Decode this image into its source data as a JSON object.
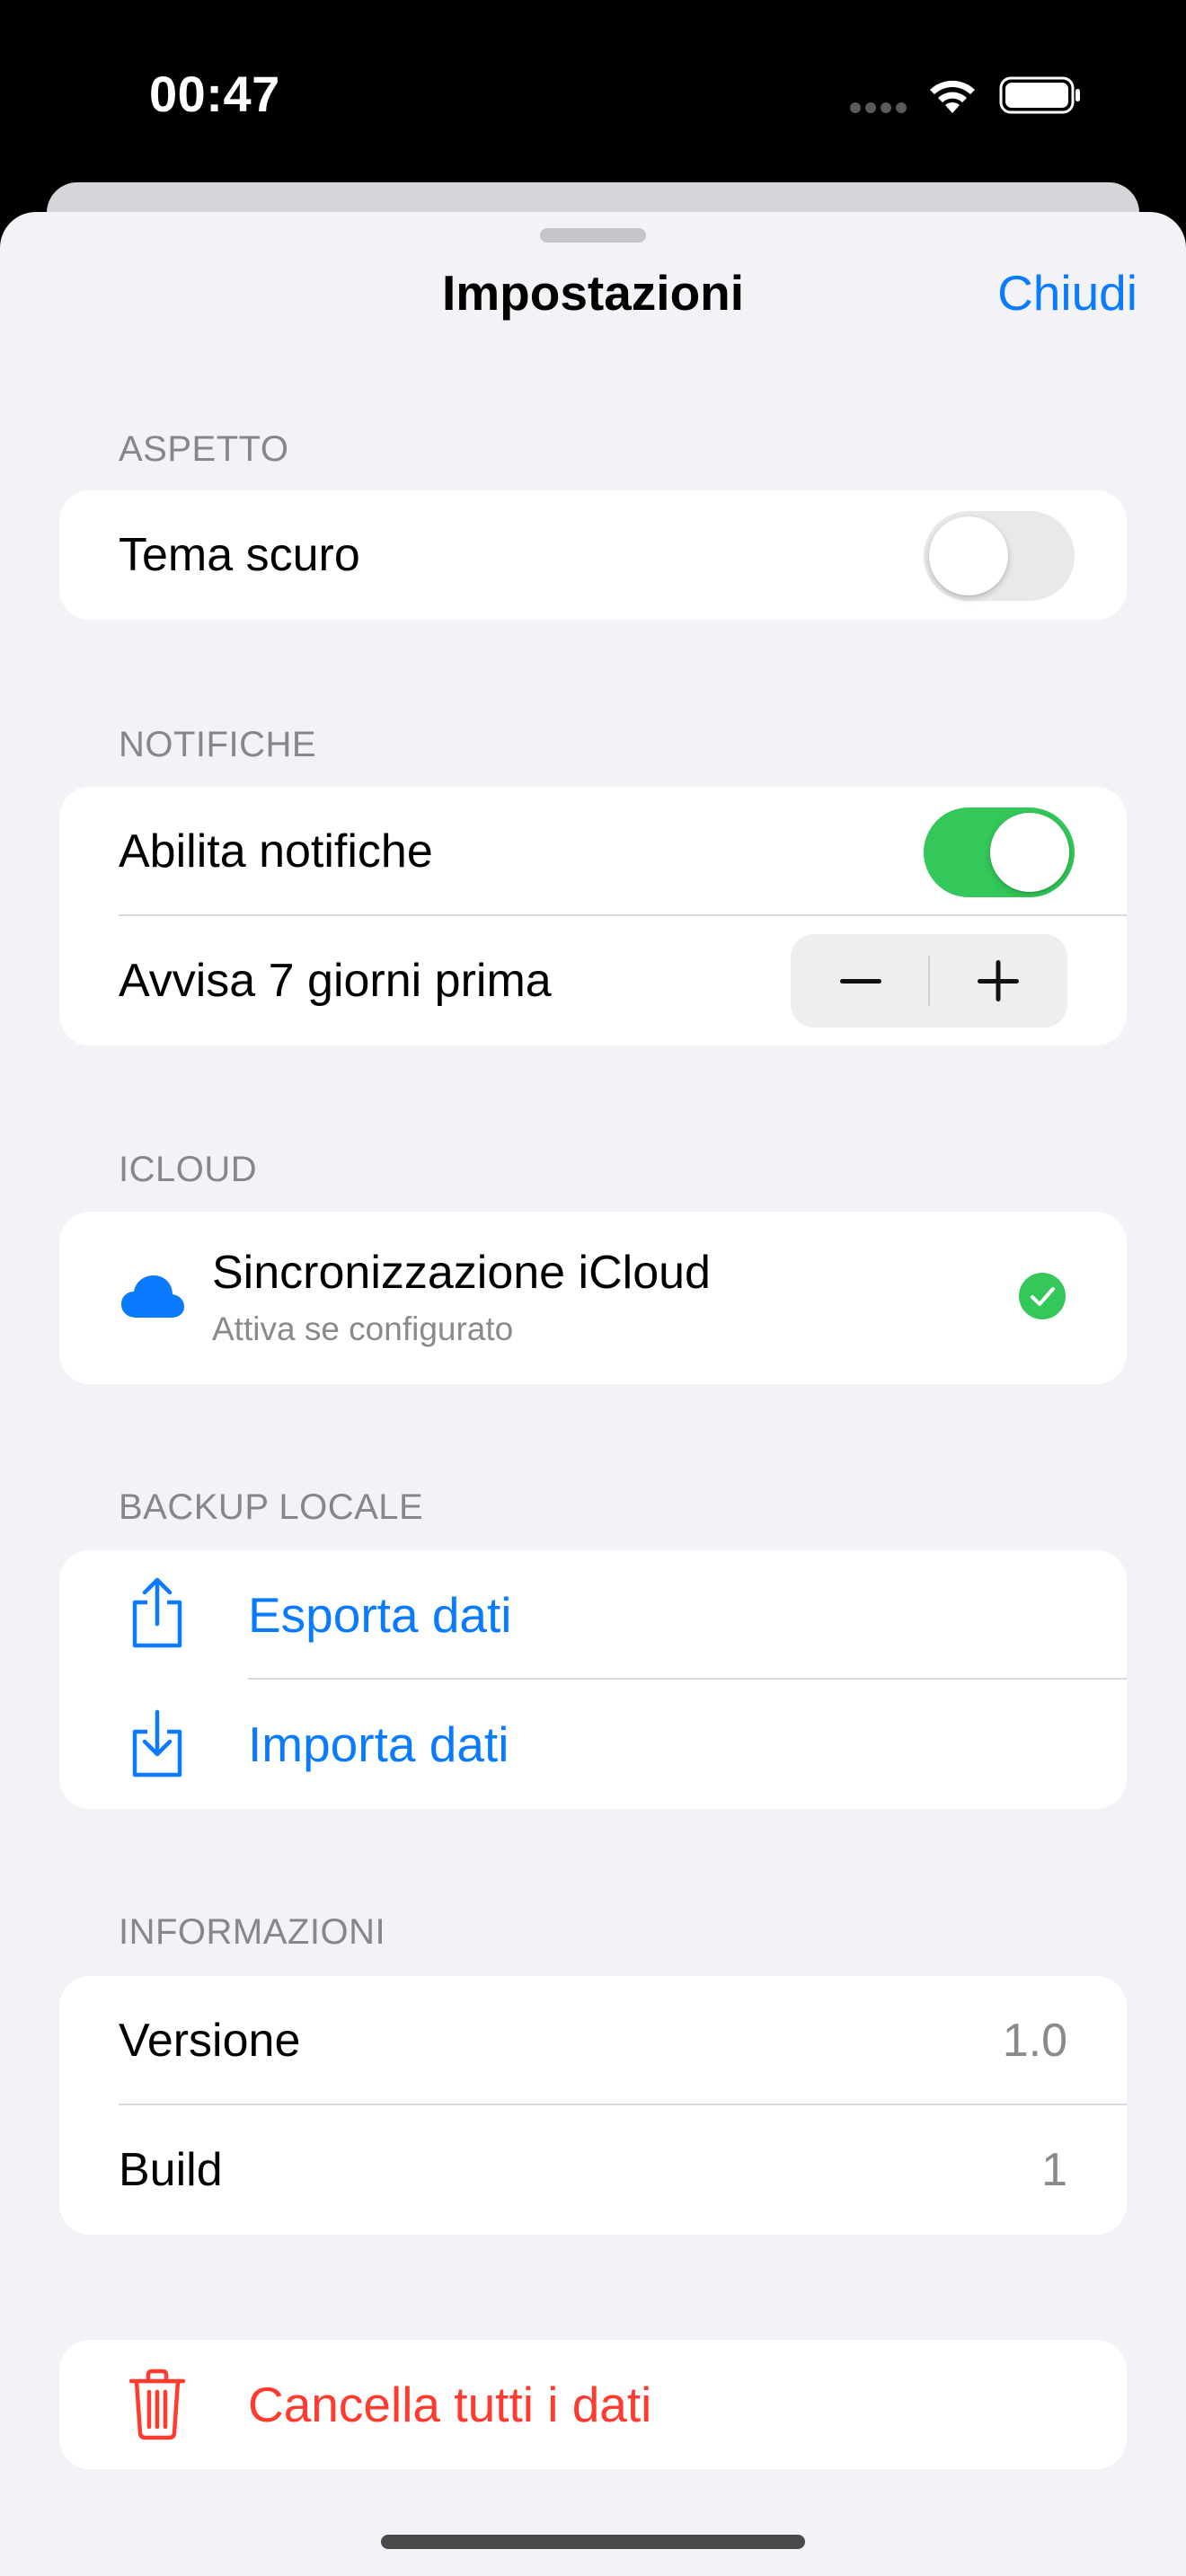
{
  "status_bar": {
    "time": "00:47"
  },
  "sheet": {
    "title": "Impostazioni",
    "close_label": "Chiudi"
  },
  "sections": {
    "appearance": {
      "header": "ASPETTO",
      "dark_theme_label": "Tema scuro",
      "dark_theme_on": false
    },
    "notifications": {
      "header": "NOTIFICHE",
      "enable_label": "Abilita notifiche",
      "enable_on": true,
      "remind_label": "Avvisa 7 giorni prima",
      "stepper_minus": "minus-icon",
      "stepper_plus": "plus-icon"
    },
    "icloud": {
      "header": "ICLOUD",
      "title": "Sincronizzazione iCloud",
      "subtitle": "Attiva se configurato",
      "status": "enabled"
    },
    "backup": {
      "header": "BACKUP LOCALE",
      "export_label": "Esporta dati",
      "import_label": "Importa dati"
    },
    "info": {
      "header": "INFORMAZIONI",
      "version_label": "Versione",
      "version_value": "1.0",
      "build_label": "Build",
      "build_value": "1"
    },
    "danger": {
      "delete_label": "Cancella tutti i dati"
    }
  },
  "colors": {
    "accent": "#0a7aff",
    "toggle_on": "#34c759",
    "destructive": "#ff3b30",
    "background": "#f2f2f7"
  }
}
